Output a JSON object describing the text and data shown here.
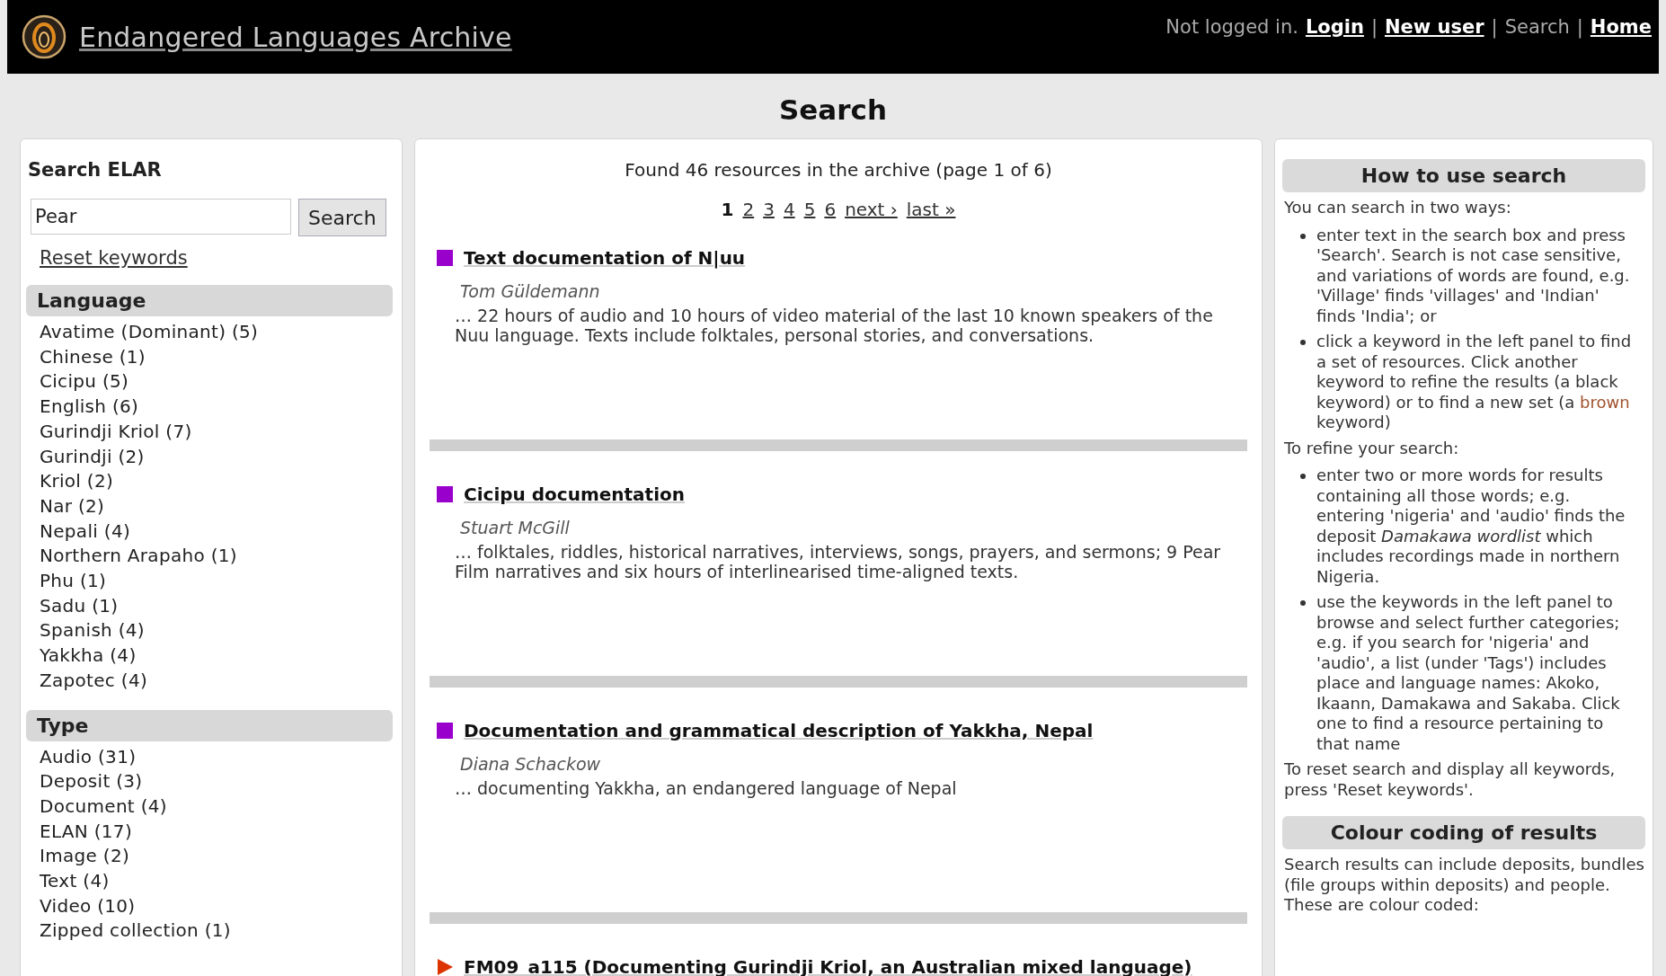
{
  "header": {
    "site_title": "Endangered Languages Archive",
    "user_nav": [
      {
        "text": "Not logged in.",
        "kind": "text"
      },
      {
        "text": "Login",
        "kind": "link"
      },
      {
        "text": "|",
        "kind": "sep"
      },
      {
        "text": "New user",
        "kind": "link"
      },
      {
        "text": "|",
        "kind": "sep"
      },
      {
        "text": "Search",
        "kind": "current"
      },
      {
        "text": "|",
        "kind": "sep"
      },
      {
        "text": "Home",
        "kind": "link"
      }
    ]
  },
  "page_title": "Search",
  "sidebar": {
    "heading": "Search ELAR",
    "search": {
      "value": "Pear",
      "button": "Search"
    },
    "reset_link": "Reset keywords",
    "facets": [
      {
        "title": "Language",
        "items": [
          "Avatime (Dominant) (5)",
          "Chinese (1)",
          "Cicipu (5)",
          "English (6)",
          "Gurindji Kriol (7)",
          "Gurindji (2)",
          "Kriol (2)",
          "Nar (2)",
          "Nepali (4)",
          "Northern Arapaho (1)",
          "Phu (1)",
          "Sadu (1)",
          "Spanish (4)",
          "Yakkha (4)",
          "Zapotec (4)"
        ]
      },
      {
        "title": "Type",
        "items": [
          "Audio (31)",
          "Deposit (3)",
          "Document (4)",
          "ELAN (17)",
          "Image (2)",
          "Text (4)",
          "Video (10)",
          "Zipped collection (1)"
        ]
      }
    ]
  },
  "results": {
    "summary": "Found 46 resources in the archive (page 1 of 6)",
    "pages": [
      {
        "label": "1",
        "selected": true
      },
      {
        "label": "2",
        "selected": false
      },
      {
        "label": "3",
        "selected": false
      },
      {
        "label": "4",
        "selected": false
      },
      {
        "label": "5",
        "selected": false
      },
      {
        "label": "6",
        "selected": false
      },
      {
        "label": "next ›",
        "selected": false
      },
      {
        "label": "last »",
        "selected": false
      }
    ],
    "items": [
      {
        "kind": "deposit",
        "color": "#9900cc",
        "title": "Text documentation of N|uu",
        "author": "Tom Güldemann",
        "snippet": "… 22 hours of audio and 10 hours of video material of the last 10 known speakers of the Nuu language. Texts include folktales, personal stories, and conversations."
      },
      {
        "kind": "deposit",
        "color": "#9900cc",
        "title": "Cicipu documentation",
        "author": "Stuart McGill",
        "snippet": "… folktales, riddles, historical narratives, interviews, songs, prayers, and sermons; 9 Pear Film narratives and six hours of interlinearised time-aligned texts."
      },
      {
        "kind": "deposit",
        "color": "#9900cc",
        "title": "Documentation and grammatical description of Yakkha, Nepal",
        "author": "Diana Schackow",
        "snippet": "… documenting Yakkha, an endangered language of Nepal"
      },
      {
        "kind": "bundle",
        "color": "#dd3300",
        "title": "FM09_a115 (Documenting Gurindji Kriol, an Australian mixed language)"
      }
    ]
  },
  "help": {
    "sections": [
      {
        "title": "How to use search",
        "blocks": [
          {
            "kind": "para",
            "parts": [
              {
                "kind": "plain",
                "text": "You can search in two ways:"
              }
            ]
          },
          {
            "kind": "list",
            "items": [
              [
                {
                  "kind": "plain",
                  "text": "enter text in the search box and press 'Search'. Search is not case sensitive, and variations of words are found, e.g. 'Village' finds 'villages' and 'Indian' finds 'India'; or"
                }
              ],
              [
                {
                  "kind": "plain",
                  "text": "click a keyword in the left panel to find a set of resources. Click another keyword to refine the results (a black keyword) or to find a new set (a "
                },
                {
                  "kind": "brown",
                  "text": "brown"
                },
                {
                  "kind": "plain",
                  "text": " keyword)"
                }
              ]
            ]
          },
          {
            "kind": "para",
            "parts": [
              {
                "kind": "plain",
                "text": "To refine your search:"
              }
            ]
          },
          {
            "kind": "list",
            "items": [
              [
                {
                  "kind": "plain",
                  "text": "enter two or more words for results containing all those words; e.g. entering 'nigeria' and 'audio' finds the deposit "
                },
                {
                  "kind": "italic",
                  "text": "Damakawa wordlist"
                },
                {
                  "kind": "plain",
                  "text": " which includes recordings made in northern Nigeria."
                }
              ],
              [
                {
                  "kind": "plain",
                  "text": "use the keywords in the left panel to browse and select further categories; e.g. if you search for 'nigeria' and 'audio', a list (under 'Tags') includes place and language names: Akoko, Ikaann, Damakawa and Sakaba. Click one to find a resource pertaining to that name"
                }
              ]
            ]
          },
          {
            "kind": "para",
            "parts": [
              {
                "kind": "plain",
                "text": "To reset search and display all keywords, press 'Reset keywords'."
              }
            ]
          }
        ]
      },
      {
        "title": "Colour coding of results",
        "blocks": [
          {
            "kind": "para",
            "parts": [
              {
                "kind": "plain",
                "text": "Search results can include deposits, bundles (file groups within deposits) and people. These are colour coded:"
              }
            ]
          }
        ]
      }
    ]
  }
}
